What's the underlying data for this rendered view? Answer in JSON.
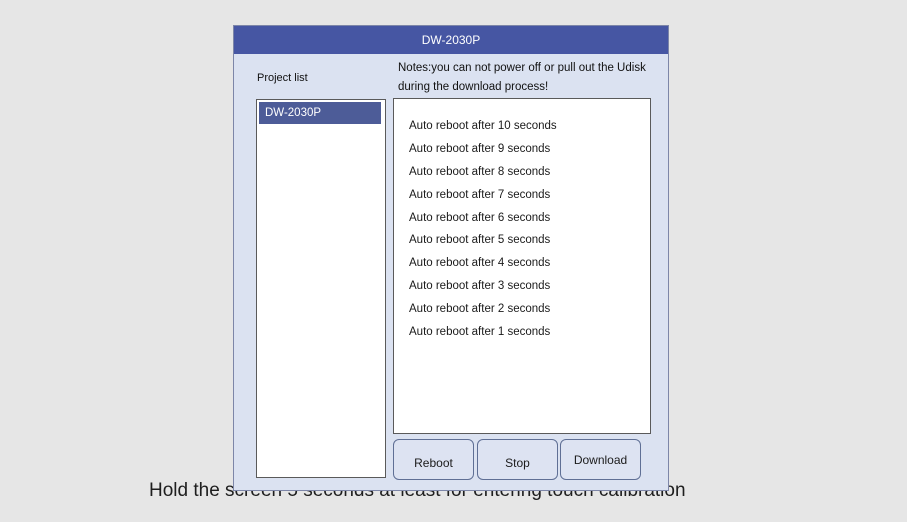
{
  "background": {
    "hint": "Hold the screen 5 seconds at least for entering touch calibration"
  },
  "dialog": {
    "title": "DW-2030P",
    "project_list_label": "Project list",
    "notes": "Notes:you can not power off or pull out the Udisk during the download process!",
    "project_items": [
      "DW-2030P"
    ],
    "log": [
      "Auto reboot after 10 seconds",
      "Auto reboot after 9 seconds",
      "Auto reboot after 8 seconds",
      "Auto reboot after 7 seconds",
      "Auto reboot after 6 seconds",
      "Auto reboot after 5 seconds",
      "Auto reboot after 4 seconds",
      "Auto reboot after 3 seconds",
      "Auto reboot after 2 seconds",
      "Auto reboot after 1 seconds"
    ],
    "buttons": {
      "reboot": "Reboot",
      "stop": "Stop",
      "download": "Download"
    }
  },
  "colors": {
    "titlebar": "#4656a3",
    "dialog_bg": "#dbe2f1",
    "selected_item": "#4d5c98",
    "page_bg": "#e6e6e6"
  }
}
